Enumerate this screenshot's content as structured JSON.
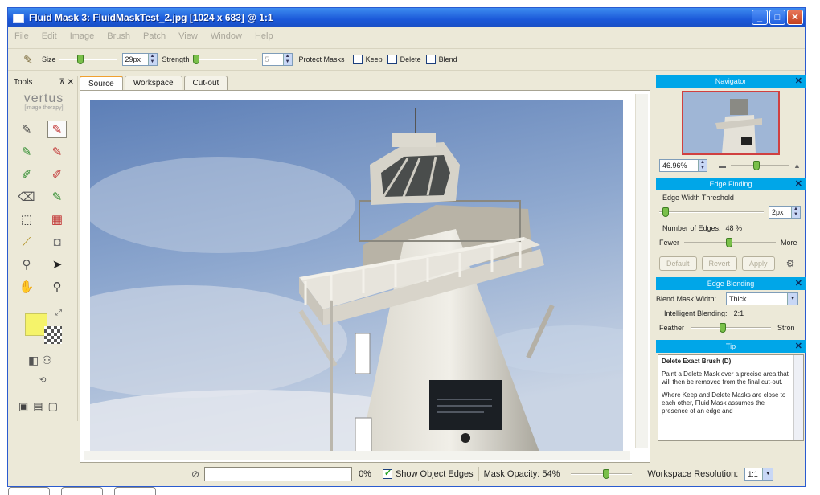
{
  "window": {
    "title": "Fluid Mask 3: FluidMaskTest_2.jpg [1024 x 683] @ 1:1",
    "minimize": "_",
    "maximize": "□",
    "close": "✕"
  },
  "menu": [
    "File",
    "Edit",
    "Image",
    "Brush",
    "Patch",
    "View",
    "Window",
    "Help"
  ],
  "toolbar": {
    "size_label": "Size",
    "size_value": "29px",
    "strength_label": "Strength",
    "strength_value": "5",
    "protect_masks_label": "Protect Masks",
    "keep_label": "Keep",
    "delete_label": "Delete",
    "blend_label": "Blend"
  },
  "tools_panel": {
    "title": "Tools",
    "pin": "⊼ ✕",
    "logo": "vertus",
    "logo_sub": "[image therapy]"
  },
  "tabs": [
    "Source",
    "Workspace",
    "Cut-out"
  ],
  "active_tab": "Source",
  "navigator": {
    "title": "Navigator",
    "zoom_value": "46.96%"
  },
  "edge_finding": {
    "title": "Edge Finding",
    "threshold_label": "Edge Width Threshold",
    "threshold_value": "2px",
    "num_edges_label": "Number of Edges:",
    "num_edges_value": "48 %",
    "fewer_label": "Fewer",
    "more_label": "More",
    "default_btn": "Default",
    "revert_btn": "Revert",
    "apply_btn": "Apply"
  },
  "edge_blending": {
    "title": "Edge Blending",
    "blend_width_label": "Blend Mask Width:",
    "blend_width_value": "Thick",
    "intelligent_label": "Intelligent Blending:",
    "intelligent_value": "2:1",
    "feather_label": "Feather",
    "strong_label": "Stron"
  },
  "tip": {
    "title": "Tip",
    "heading": "Delete Exact Brush (D)",
    "para1": "Paint a Delete Mask over a precise area that will then be removed from the final cut-out.",
    "para2": "Where Keep and Delete Masks are close to each other, Fluid Mask assumes the presence of an edge and"
  },
  "status": {
    "progress_pct": "0%",
    "show_edges_label": "Show Object Edges",
    "mask_opacity_label": "Mask Opacity: 54%",
    "workspace_res_label": "Workspace Resolution:",
    "workspace_res_value": "1:1"
  }
}
